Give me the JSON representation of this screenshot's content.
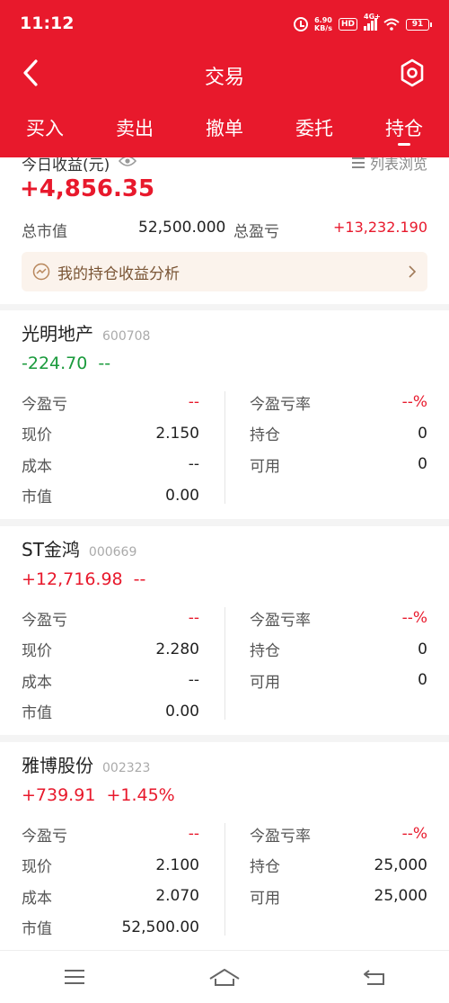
{
  "status": {
    "time": "11:12",
    "speed_value": "6.90",
    "speed_unit": "KB/s",
    "hd": "HD",
    "network": "4G+",
    "battery": "91"
  },
  "header": {
    "title": "交易",
    "tabs": [
      {
        "label": "买入"
      },
      {
        "label": "卖出"
      },
      {
        "label": "撤单"
      },
      {
        "label": "委托"
      },
      {
        "label": "持仓",
        "active": true
      }
    ]
  },
  "summary": {
    "today_label": "今日收益(元)",
    "list_view_label": "列表浏览",
    "today_value": "+4,856.35",
    "market_value_label": "总市值",
    "market_value": "52,500.000",
    "total_pl_label": "总盈亏",
    "total_pl": "+13,232.190",
    "analysis_label": "我的持仓收益分析"
  },
  "labels": {
    "today_pl": "今盈亏",
    "today_pl_rate": "今盈亏率",
    "price": "现价",
    "position": "持仓",
    "cost": "成本",
    "available": "可用",
    "market_value": "市值"
  },
  "holdings": [
    {
      "name": "光明地产",
      "code": "600708",
      "change": "-224.70",
      "change_pct": "--",
      "today_pl": "--",
      "today_pl_rate": "--%",
      "price": "2.150",
      "position": "0",
      "cost": "--",
      "available": "0",
      "market_value": "0.00"
    },
    {
      "name": "ST金鸿",
      "code": "000669",
      "change": "+12,716.98",
      "change_pct": "--",
      "today_pl": "--",
      "today_pl_rate": "--%",
      "price": "2.280",
      "position": "0",
      "cost": "--",
      "available": "0",
      "market_value": "0.00"
    },
    {
      "name": "雅博股份",
      "code": "002323",
      "change": "+739.91",
      "change_pct": "+1.45%",
      "today_pl": "--",
      "today_pl_rate": "--%",
      "price": "2.100",
      "position": "25,000",
      "cost": "2.070",
      "available": "25,000",
      "market_value": "52,500.00"
    }
  ],
  "icons": {
    "back": "back-arrow-icon",
    "settings": "settings-hexagon-icon",
    "eye": "eye-icon",
    "list": "list-icon",
    "trend": "trend-chart-icon",
    "chevron": "chevron-right-icon",
    "menu": "menu-icon",
    "home": "home-icon",
    "return": "return-icon"
  },
  "colors": {
    "brand_red": "#e8192c",
    "loss_green": "#1a9a3c",
    "analysis_bg": "#fbf3ec"
  }
}
